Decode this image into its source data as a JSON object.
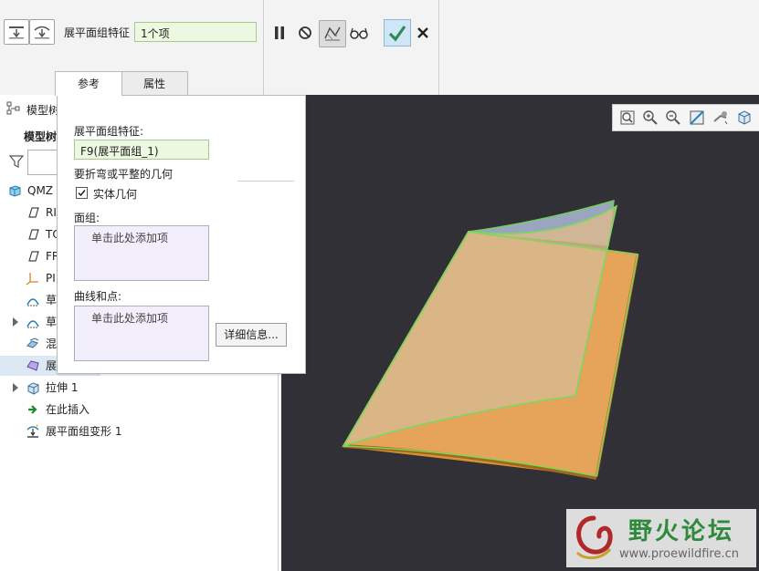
{
  "ribbon": {
    "feature_label": "展平面组特征",
    "feature_value": "1个项",
    "tabs": [
      "参考",
      "属性"
    ],
    "icons": [
      "flatten-down-icon",
      "flatten-arc-icon",
      "pause-icon",
      "no-preview-icon",
      "geometry-preview-icon",
      "glasses-icon",
      "confirm-check-icon",
      "cancel-x-icon"
    ],
    "accent_color": "#2e8b57"
  },
  "tree": {
    "header": "模型树",
    "subheader": "模型树",
    "items": [
      {
        "label": "QMZ",
        "icon": "part-cube-icon"
      },
      {
        "label": "RI",
        "icon": "datum-plane-icon"
      },
      {
        "label": "TO",
        "icon": "datum-plane-icon"
      },
      {
        "label": "FR",
        "icon": "datum-plane-icon"
      },
      {
        "label": "PI",
        "icon": "coordinate-system-icon"
      },
      {
        "label": "草",
        "icon": "sketch-icon"
      },
      {
        "label": "草",
        "icon": "sketch-icon"
      },
      {
        "label": "混",
        "icon": "blend-icon"
      },
      {
        "label": "展",
        "icon": "flatten-quilt-icon"
      },
      {
        "label": "拉伸 1",
        "icon": "extrude-icon"
      },
      {
        "label": "在此插入",
        "icon": "insert-arrow-icon"
      },
      {
        "label": "展平面组变形 1",
        "icon": "flatten-deform-icon"
      }
    ]
  },
  "popup": {
    "flatten_feature_label": "展平面组特征:",
    "flatten_feature_value": "F9(展平面组_1)",
    "geom_label": "要折弯或平整的几何",
    "solid_checkbox_label": "实体几何",
    "solid_checked": true,
    "quilts_label": "面组:",
    "quilts_hint": "单击此处添加项",
    "curves_label": "曲线和点:",
    "curves_hint": "单击此处添加项",
    "details_button": "详细信息..."
  },
  "viewport": {
    "background": "#303036",
    "toolbar_icons": [
      "refit-icon",
      "zoom-in-icon",
      "zoom-out-icon",
      "repaint-icon",
      "spin-center-icon",
      "view-orientation-icon"
    ]
  },
  "watermark": {
    "title": "野火论坛",
    "url": "www.proewildfire.cn"
  }
}
